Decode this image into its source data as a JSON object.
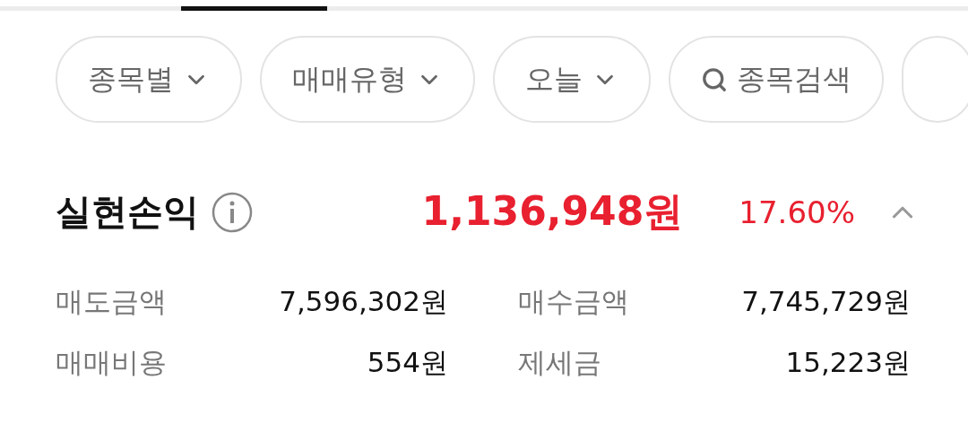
{
  "tabs": [
    {
      "selected": false
    },
    {
      "selected": true
    },
    {
      "selected": false
    },
    {
      "selected": false
    },
    {
      "selected": false
    },
    {
      "selected": false
    }
  ],
  "filters": [
    {
      "kind": "dropdown",
      "label": "종목별"
    },
    {
      "kind": "dropdown",
      "label": "매매유형"
    },
    {
      "kind": "dropdown",
      "label": "오늘"
    },
    {
      "kind": "search",
      "label": "종목검색"
    },
    {
      "kind": "blank"
    }
  ],
  "summary": {
    "title": "실현손익",
    "amount": "1,136,948원",
    "rate": "17.60%",
    "expanded": true,
    "details": [
      {
        "label": "매도금액",
        "value": "7,596,302원"
      },
      {
        "label": "매수금액",
        "value": "7,745,729원"
      },
      {
        "label": "매매비용",
        "value": "554원"
      },
      {
        "label": "제세금",
        "value": "15,223원"
      }
    ]
  }
}
